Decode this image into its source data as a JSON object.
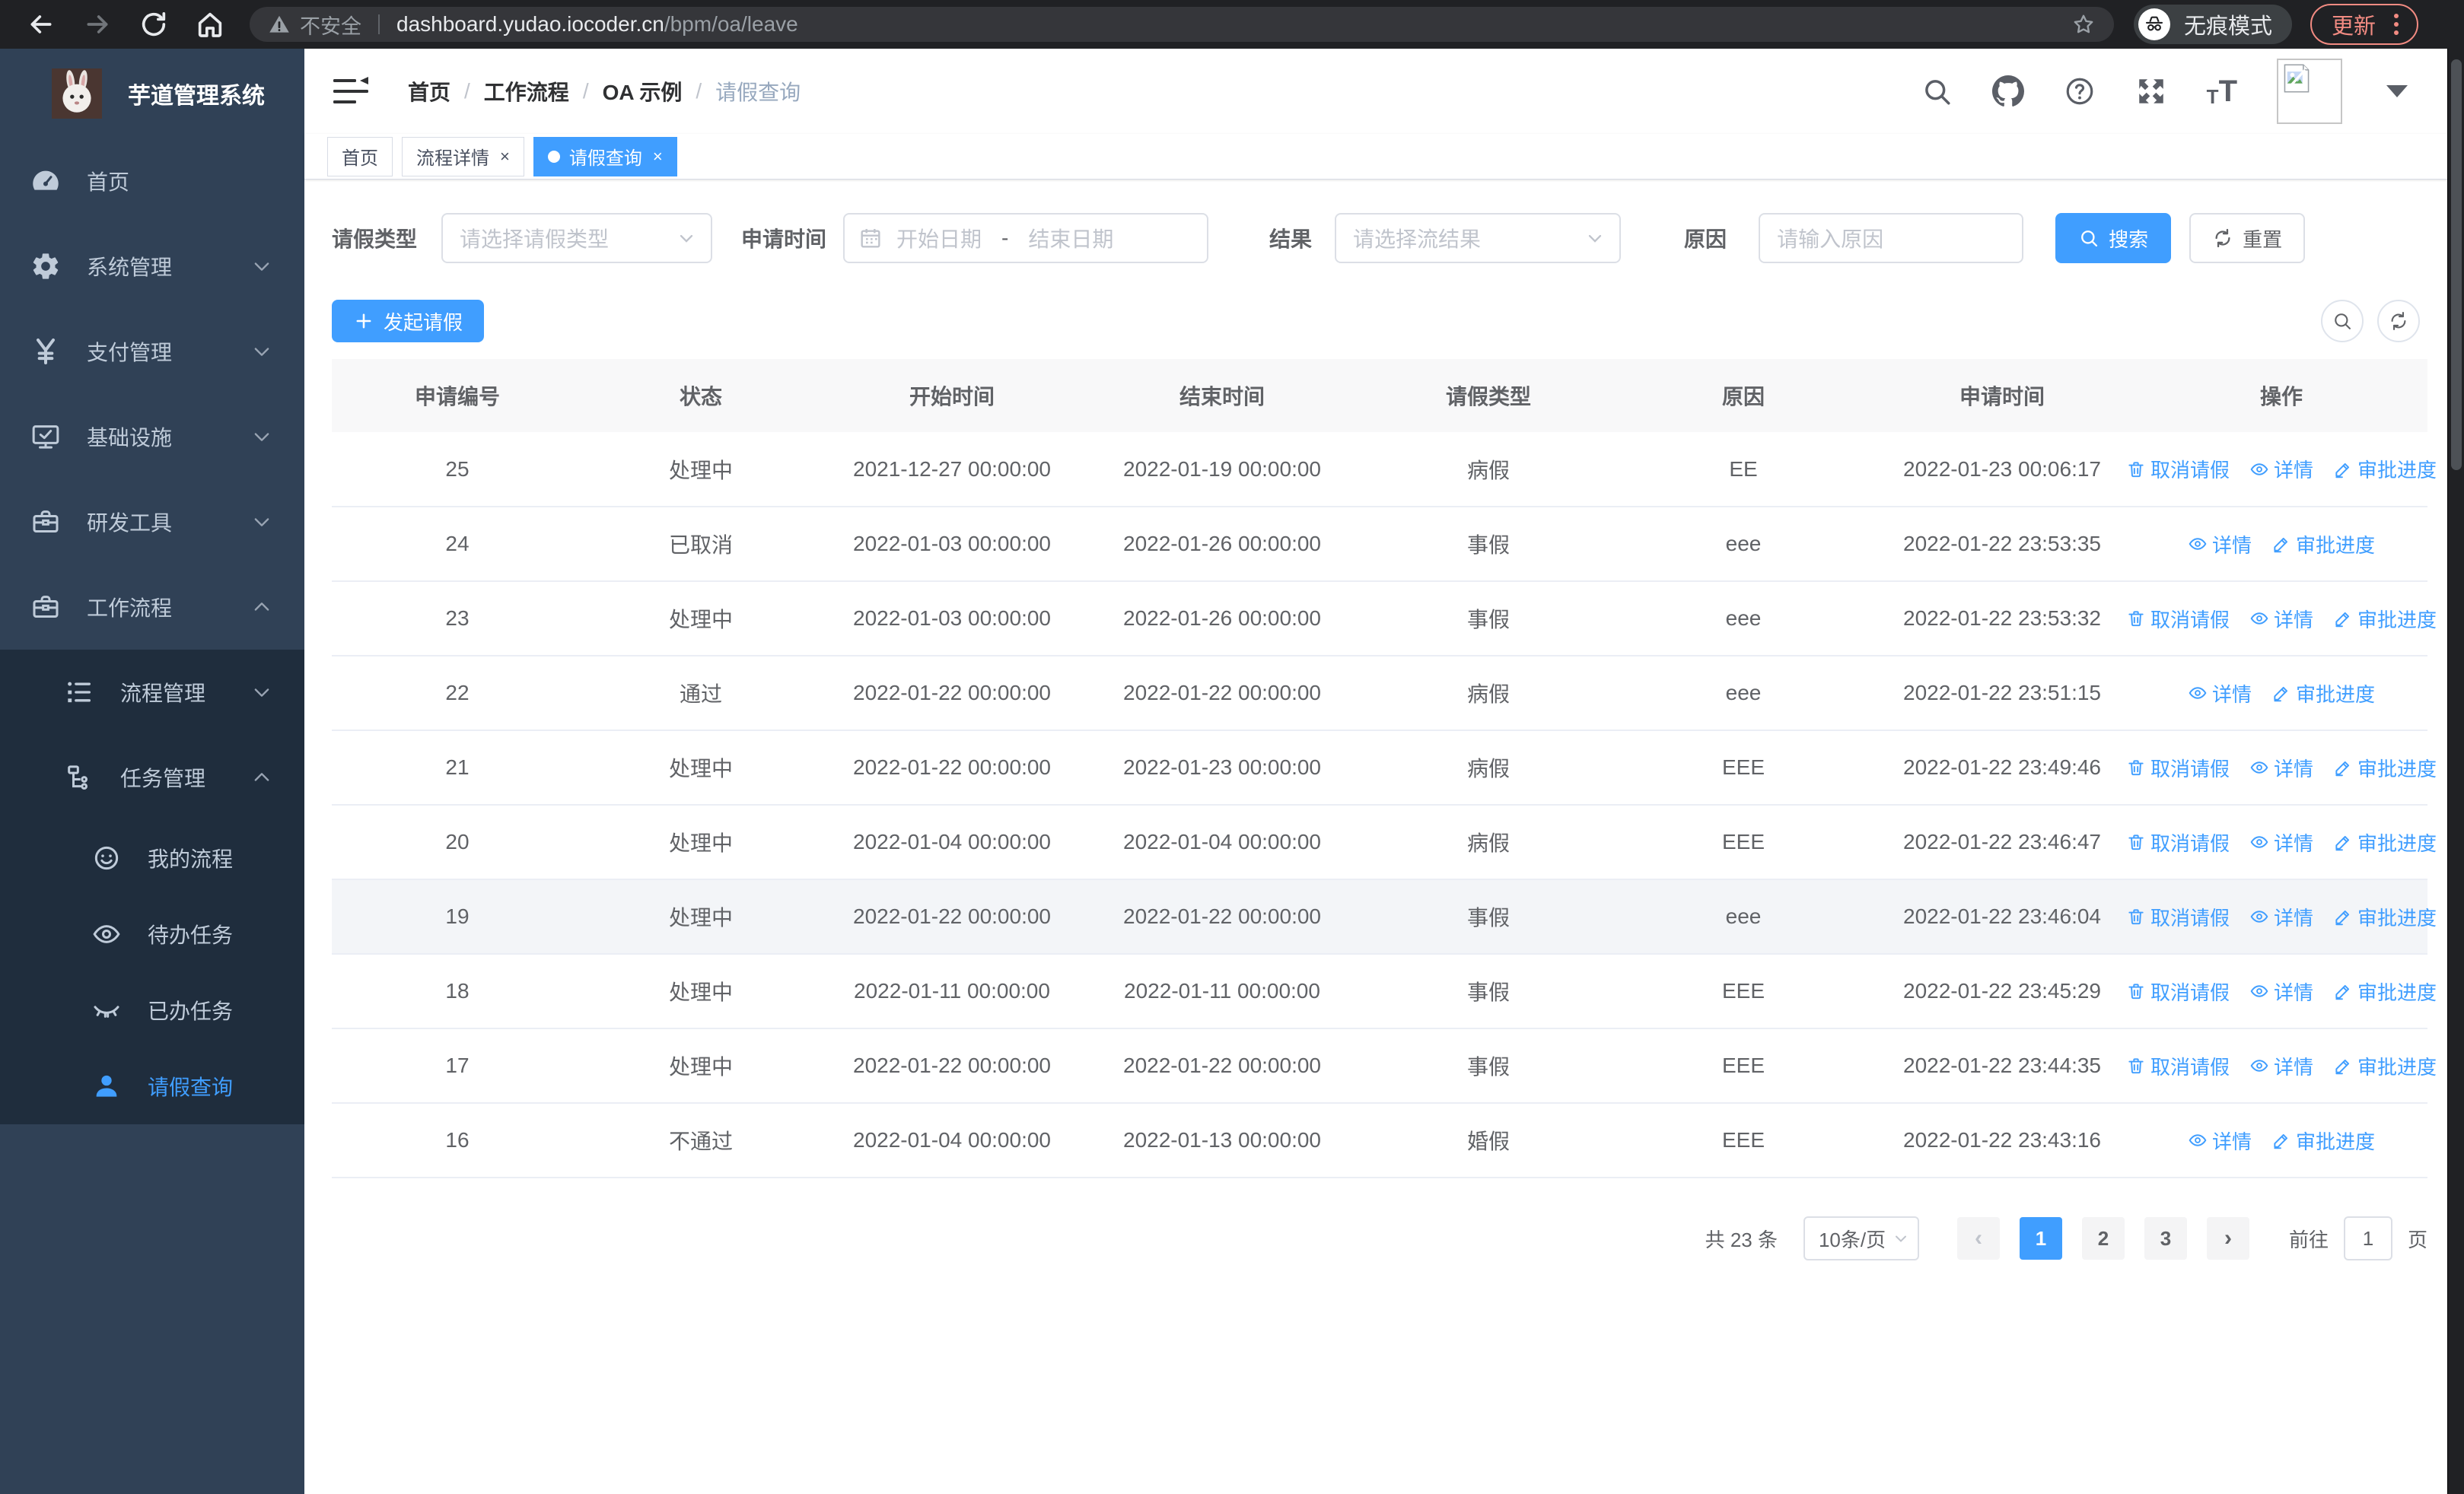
{
  "browser": {
    "security_label": "不安全",
    "url_host": "dashboard.yudao.iocoder.cn",
    "url_path": "/bpm/oa/leave",
    "incognito_label": "无痕模式",
    "update_label": "更新"
  },
  "colors": {
    "primary": "#409eff",
    "sidebar_bg": "#304156",
    "submenu_bg": "#1f2d3d",
    "chrome_bg": "#202124",
    "update_accent": "#f28b82"
  },
  "app": {
    "title": "芋道管理系统"
  },
  "sidebar": {
    "menu": [
      {
        "icon": "dashboard-icon",
        "label": "首页",
        "level": 1,
        "chevron": "",
        "dark": false,
        "active": false
      },
      {
        "icon": "gear-icon",
        "label": "系统管理",
        "level": 1,
        "chevron": "down",
        "dark": false,
        "active": false
      },
      {
        "icon": "yen-icon",
        "label": "支付管理",
        "level": 1,
        "chevron": "down",
        "dark": false,
        "active": false
      },
      {
        "icon": "infra-icon",
        "label": "基础设施",
        "level": 1,
        "chevron": "down",
        "dark": false,
        "active": false
      },
      {
        "icon": "toolbox-icon",
        "label": "研发工具",
        "level": 1,
        "chevron": "down",
        "dark": false,
        "active": false
      },
      {
        "icon": "workflow-icon",
        "label": "工作流程",
        "level": 1,
        "chevron": "up",
        "dark": false,
        "active": false
      },
      {
        "icon": "list-icon",
        "label": "流程管理",
        "level": 2,
        "chevron": "down",
        "dark": true,
        "active": false
      },
      {
        "icon": "tree-icon",
        "label": "任务管理",
        "level": 2,
        "chevron": "up",
        "dark": true,
        "active": false
      },
      {
        "icon": "face-icon",
        "label": "我的流程",
        "level": 3,
        "chevron": "",
        "dark": true,
        "active": false
      },
      {
        "icon": "eye-icon",
        "label": "待办任务",
        "level": 3,
        "chevron": "",
        "dark": true,
        "active": false
      },
      {
        "icon": "eye-closed-icon",
        "label": "已办任务",
        "level": 3,
        "chevron": "",
        "dark": true,
        "active": false
      },
      {
        "icon": "user-icon",
        "label": "请假查询",
        "level": 3,
        "chevron": "",
        "dark": true,
        "active": true
      }
    ]
  },
  "breadcrumb": {
    "items": [
      "首页",
      "工作流程",
      "OA 示例",
      "请假查询"
    ]
  },
  "tabs": {
    "items": [
      {
        "label": "首页",
        "closable": false,
        "active": false
      },
      {
        "label": "流程详情",
        "closable": true,
        "active": false
      },
      {
        "label": "请假查询",
        "closable": true,
        "active": true
      }
    ]
  },
  "filter": {
    "type_label": "请假类型",
    "type_placeholder": "请选择请假类型",
    "time_label": "申请时间",
    "time_start_placeholder": "开始日期",
    "time_separator": "-",
    "time_end_placeholder": "结束日期",
    "result_label": "结果",
    "result_placeholder": "请选择流结果",
    "reason_label": "原因",
    "reason_placeholder": "请输入原因",
    "search_label": "搜索",
    "reset_label": "重置"
  },
  "toolbar": {
    "create_label": "发起请假"
  },
  "table": {
    "columns": [
      "申请编号",
      "状态",
      "开始时间",
      "结束时间",
      "请假类型",
      "原因",
      "申请时间",
      "操作"
    ],
    "action_labels": {
      "cancel": "取消请假",
      "detail": "详情",
      "progress": "审批进度"
    },
    "rows": [
      {
        "id": "25",
        "status": "处理中",
        "start": "2021-12-27 00:00:00",
        "end": "2022-01-19 00:00:00",
        "type": "病假",
        "reason": "EE",
        "apply_time": "2022-01-23 00:06:17",
        "actions": [
          "cancel",
          "detail",
          "progress"
        ],
        "highlight": false
      },
      {
        "id": "24",
        "status": "已取消",
        "start": "2022-01-03 00:00:00",
        "end": "2022-01-26 00:00:00",
        "type": "事假",
        "reason": "eee",
        "apply_time": "2022-01-22 23:53:35",
        "actions": [
          "detail",
          "progress"
        ],
        "highlight": false
      },
      {
        "id": "23",
        "status": "处理中",
        "start": "2022-01-03 00:00:00",
        "end": "2022-01-26 00:00:00",
        "type": "事假",
        "reason": "eee",
        "apply_time": "2022-01-22 23:53:32",
        "actions": [
          "cancel",
          "detail",
          "progress"
        ],
        "highlight": false
      },
      {
        "id": "22",
        "status": "通过",
        "start": "2022-01-22 00:00:00",
        "end": "2022-01-22 00:00:00",
        "type": "病假",
        "reason": "eee",
        "apply_time": "2022-01-22 23:51:15",
        "actions": [
          "detail",
          "progress"
        ],
        "highlight": false
      },
      {
        "id": "21",
        "status": "处理中",
        "start": "2022-01-22 00:00:00",
        "end": "2022-01-23 00:00:00",
        "type": "病假",
        "reason": "EEE",
        "apply_time": "2022-01-22 23:49:46",
        "actions": [
          "cancel",
          "detail",
          "progress"
        ],
        "highlight": false
      },
      {
        "id": "20",
        "status": "处理中",
        "start": "2022-01-04 00:00:00",
        "end": "2022-01-04 00:00:00",
        "type": "病假",
        "reason": "EEE",
        "apply_time": "2022-01-22 23:46:47",
        "actions": [
          "cancel",
          "detail",
          "progress"
        ],
        "highlight": false
      },
      {
        "id": "19",
        "status": "处理中",
        "start": "2022-01-22 00:00:00",
        "end": "2022-01-22 00:00:00",
        "type": "事假",
        "reason": "eee",
        "apply_time": "2022-01-22 23:46:04",
        "actions": [
          "cancel",
          "detail",
          "progress"
        ],
        "highlight": true
      },
      {
        "id": "18",
        "status": "处理中",
        "start": "2022-01-11 00:00:00",
        "end": "2022-01-11 00:00:00",
        "type": "事假",
        "reason": "EEE",
        "apply_time": "2022-01-22 23:45:29",
        "actions": [
          "cancel",
          "detail",
          "progress"
        ],
        "highlight": false
      },
      {
        "id": "17",
        "status": "处理中",
        "start": "2022-01-22 00:00:00",
        "end": "2022-01-22 00:00:00",
        "type": "事假",
        "reason": "EEE",
        "apply_time": "2022-01-22 23:44:35",
        "actions": [
          "cancel",
          "detail",
          "progress"
        ],
        "highlight": false
      },
      {
        "id": "16",
        "status": "不通过",
        "start": "2022-01-04 00:00:00",
        "end": "2022-01-13 00:00:00",
        "type": "婚假",
        "reason": "EEE",
        "apply_time": "2022-01-22 23:43:16",
        "actions": [
          "detail",
          "progress"
        ],
        "highlight": false
      }
    ]
  },
  "pagination": {
    "total_label": "共 23 条",
    "page_size": "10条/页",
    "prev": "‹",
    "next": "›",
    "pages": [
      "1",
      "2",
      "3"
    ],
    "active_page": "1",
    "jump_prefix": "前往",
    "jump_value": "1",
    "jump_suffix": "页"
  }
}
